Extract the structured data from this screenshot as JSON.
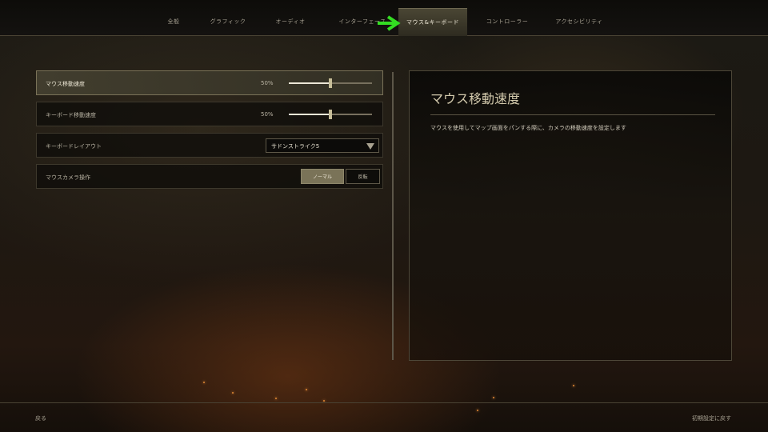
{
  "tabs": [
    {
      "label": "全般"
    },
    {
      "label": "グラフィック"
    },
    {
      "label": "オーディオ"
    },
    {
      "label": "インターフェース"
    },
    {
      "label": "マウス&キーボード"
    },
    {
      "label": "コントローラー"
    },
    {
      "label": "アクセシビリティ"
    }
  ],
  "active_tab_index": 4,
  "settings": {
    "mouse_speed": {
      "label": "マウス移動速度",
      "value_text": "50%",
      "level": 0.5
    },
    "keyboard_speed": {
      "label": "キーボード移動速度",
      "value_text": "50%",
      "level": 0.5
    },
    "keyboard_layout": {
      "label": "キーボードレイアウト",
      "selected": "サドンストライク5"
    },
    "mouse_camera": {
      "label": "マウスカメラ操作",
      "options": [
        "ノーマル",
        "反転"
      ],
      "selected_index": 0
    }
  },
  "detail_panel": {
    "title": "マウス移動速度",
    "description": "マウスを使用してマップ画面をパンする際に、カメラの移動速度を設定します"
  },
  "footer": {
    "back_label": "戻る",
    "reset_label": "初期設定に戻す"
  },
  "colors": {
    "accent_arrow": "#33dd22",
    "active_tab_bg": "#4a4634",
    "selected_option_bg": "#7a7358"
  }
}
